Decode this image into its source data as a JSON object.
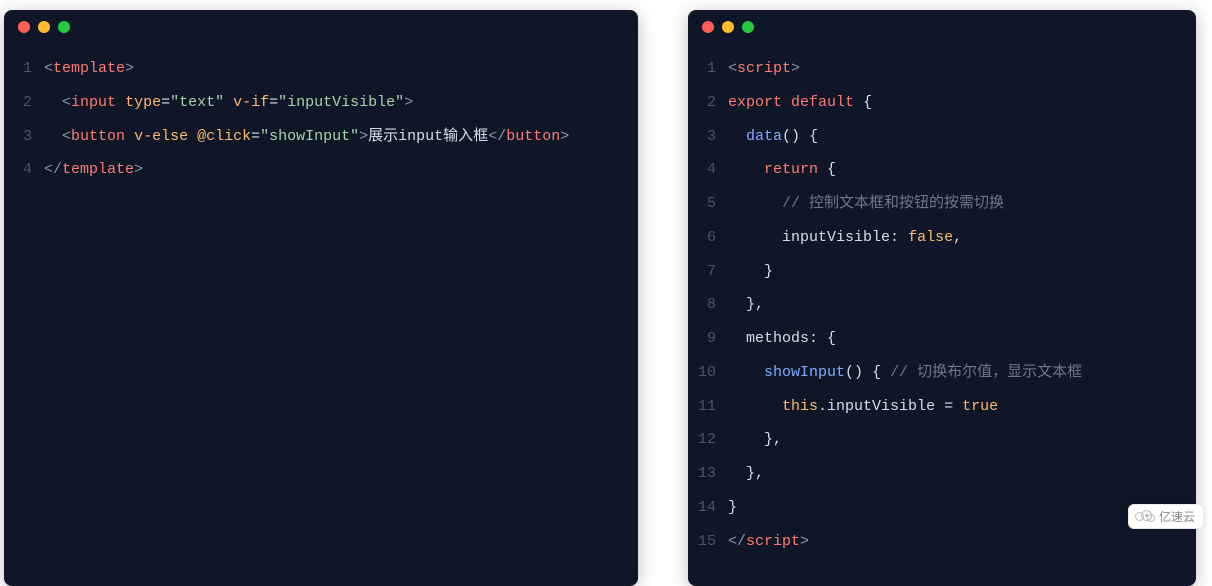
{
  "watermark": {
    "text": "亿速云"
  },
  "colors": {
    "panel_bg": "#0e1628",
    "dot_red": "#ff5f56",
    "dot_yellow": "#ffbd2e",
    "dot_green": "#27c93f"
  },
  "left_code": {
    "lines": [
      {
        "n": "1",
        "tokens": [
          {
            "c": "t-bracket",
            "t": "<"
          },
          {
            "c": "t-tag",
            "t": "template"
          },
          {
            "c": "t-bracket",
            "t": ">"
          }
        ]
      },
      {
        "n": "2",
        "tokens": [
          {
            "c": "t-plain",
            "t": "  "
          },
          {
            "c": "t-bracket",
            "t": "<"
          },
          {
            "c": "t-tag",
            "t": "input"
          },
          {
            "c": "t-plain",
            "t": " "
          },
          {
            "c": "t-attr",
            "t": "type"
          },
          {
            "c": "t-eq",
            "t": "="
          },
          {
            "c": "t-str",
            "t": "\"text\""
          },
          {
            "c": "t-plain",
            "t": " "
          },
          {
            "c": "t-attr",
            "t": "v-if"
          },
          {
            "c": "t-eq",
            "t": "="
          },
          {
            "c": "t-str",
            "t": "\"inputVisible\""
          },
          {
            "c": "t-bracket",
            "t": ">"
          }
        ]
      },
      {
        "n": "3",
        "tokens": [
          {
            "c": "t-plain",
            "t": "  "
          },
          {
            "c": "t-bracket",
            "t": "<"
          },
          {
            "c": "t-tag",
            "t": "button"
          },
          {
            "c": "t-plain",
            "t": " "
          },
          {
            "c": "t-attr",
            "t": "v-else"
          },
          {
            "c": "t-plain",
            "t": " "
          },
          {
            "c": "t-attr",
            "t": "@click"
          },
          {
            "c": "t-eq",
            "t": "="
          },
          {
            "c": "t-str",
            "t": "\"showInput\""
          },
          {
            "c": "t-bracket",
            "t": ">"
          },
          {
            "c": "t-plain",
            "t": "展示input输入框"
          },
          {
            "c": "t-bracket",
            "t": "</"
          },
          {
            "c": "t-tag",
            "t": "button"
          },
          {
            "c": "t-bracket",
            "t": ">"
          }
        ]
      },
      {
        "n": "4",
        "tokens": [
          {
            "c": "t-bracket",
            "t": "</"
          },
          {
            "c": "t-tag",
            "t": "template"
          },
          {
            "c": "t-bracket",
            "t": ">"
          }
        ]
      }
    ]
  },
  "right_code": {
    "lines": [
      {
        "n": "1",
        "tokens": [
          {
            "c": "t-bracket",
            "t": "<"
          },
          {
            "c": "t-tag",
            "t": "script"
          },
          {
            "c": "t-bracket",
            "t": ">"
          }
        ]
      },
      {
        "n": "2",
        "tokens": [
          {
            "c": "t-kw",
            "t": "export"
          },
          {
            "c": "t-plain",
            "t": " "
          },
          {
            "c": "t-kw",
            "t": "default"
          },
          {
            "c": "t-plain",
            "t": " "
          },
          {
            "c": "t-punc",
            "t": "{"
          }
        ]
      },
      {
        "n": "3",
        "tokens": [
          {
            "c": "t-plain",
            "t": "  "
          },
          {
            "c": "t-fn",
            "t": "data"
          },
          {
            "c": "t-punc",
            "t": "()"
          },
          {
            "c": "t-plain",
            "t": " "
          },
          {
            "c": "t-punc",
            "t": "{"
          }
        ]
      },
      {
        "n": "4",
        "tokens": [
          {
            "c": "t-plain",
            "t": "    "
          },
          {
            "c": "t-kw",
            "t": "return"
          },
          {
            "c": "t-plain",
            "t": " "
          },
          {
            "c": "t-punc",
            "t": "{"
          }
        ]
      },
      {
        "n": "5",
        "tokens": [
          {
            "c": "t-plain",
            "t": "      "
          },
          {
            "c": "t-comment",
            "t": "// 控制文本框和按钮的按需切换"
          }
        ]
      },
      {
        "n": "6",
        "tokens": [
          {
            "c": "t-plain",
            "t": "      "
          },
          {
            "c": "t-prop",
            "t": "inputVisible"
          },
          {
            "c": "t-punc",
            "t": ": "
          },
          {
            "c": "t-bool",
            "t": "false"
          },
          {
            "c": "t-punc",
            "t": ","
          }
        ]
      },
      {
        "n": "7",
        "tokens": [
          {
            "c": "t-plain",
            "t": "    "
          },
          {
            "c": "t-punc",
            "t": "}"
          }
        ]
      },
      {
        "n": "8",
        "tokens": [
          {
            "c": "t-plain",
            "t": "  "
          },
          {
            "c": "t-punc",
            "t": "},"
          }
        ]
      },
      {
        "n": "9",
        "tokens": [
          {
            "c": "t-plain",
            "t": "  "
          },
          {
            "c": "t-prop",
            "t": "methods"
          },
          {
            "c": "t-punc",
            "t": ": "
          },
          {
            "c": "t-punc",
            "t": "{"
          }
        ]
      },
      {
        "n": "10",
        "tokens": [
          {
            "c": "t-plain",
            "t": "    "
          },
          {
            "c": "t-fn",
            "t": "showInput"
          },
          {
            "c": "t-punc",
            "t": "()"
          },
          {
            "c": "t-plain",
            "t": " "
          },
          {
            "c": "t-punc",
            "t": "{"
          },
          {
            "c": "t-plain",
            "t": " "
          },
          {
            "c": "t-comment",
            "t": "// 切换布尔值，显示文本框"
          }
        ]
      },
      {
        "n": "11",
        "tokens": [
          {
            "c": "t-plain",
            "t": "      "
          },
          {
            "c": "t-this",
            "t": "this"
          },
          {
            "c": "t-punc",
            "t": "."
          },
          {
            "c": "t-prop",
            "t": "inputVisible"
          },
          {
            "c": "t-plain",
            "t": " "
          },
          {
            "c": "t-punc",
            "t": "="
          },
          {
            "c": "t-plain",
            "t": " "
          },
          {
            "c": "t-bool",
            "t": "true"
          }
        ]
      },
      {
        "n": "12",
        "tokens": [
          {
            "c": "t-plain",
            "t": "    "
          },
          {
            "c": "t-punc",
            "t": "},"
          }
        ]
      },
      {
        "n": "13",
        "tokens": [
          {
            "c": "t-plain",
            "t": "  "
          },
          {
            "c": "t-punc",
            "t": "},"
          }
        ]
      },
      {
        "n": "14",
        "tokens": [
          {
            "c": "t-punc",
            "t": "}"
          }
        ]
      },
      {
        "n": "15",
        "tokens": [
          {
            "c": "t-bracket",
            "t": "</"
          },
          {
            "c": "t-tag",
            "t": "script"
          },
          {
            "c": "t-bracket",
            "t": ">"
          }
        ]
      }
    ]
  }
}
